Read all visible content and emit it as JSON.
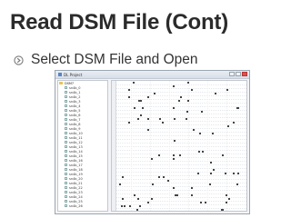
{
  "slide": {
    "title": "Read DSM File (Cont)",
    "bullet": "Select DSM File and Open",
    "bullet_icon": "circled-arrow-icon",
    "accent_color": "#7a7a7a"
  },
  "window": {
    "title": "DL Project",
    "tree_root": "DSM7",
    "tree_items": [
      "sn4b_0",
      "sn4b_1",
      "sn4b_2",
      "sn4b_3",
      "sn4b_4",
      "sn4b_5",
      "sn4b_6",
      "sn4b_7",
      "sn4b_8",
      "sn4b_9",
      "sn4b_10",
      "sn4b_11",
      "sn4b_12",
      "sn4b_13",
      "sn4b_14",
      "sn4b_15",
      "sn4b_16",
      "sn4b_17",
      "sn4b_18",
      "sn4b_19",
      "sn4b_20",
      "sn4b_21",
      "sn4b_22",
      "sn4b_23",
      "sn4b_24",
      "sn4b_25",
      "sn4b_26"
    ]
  }
}
